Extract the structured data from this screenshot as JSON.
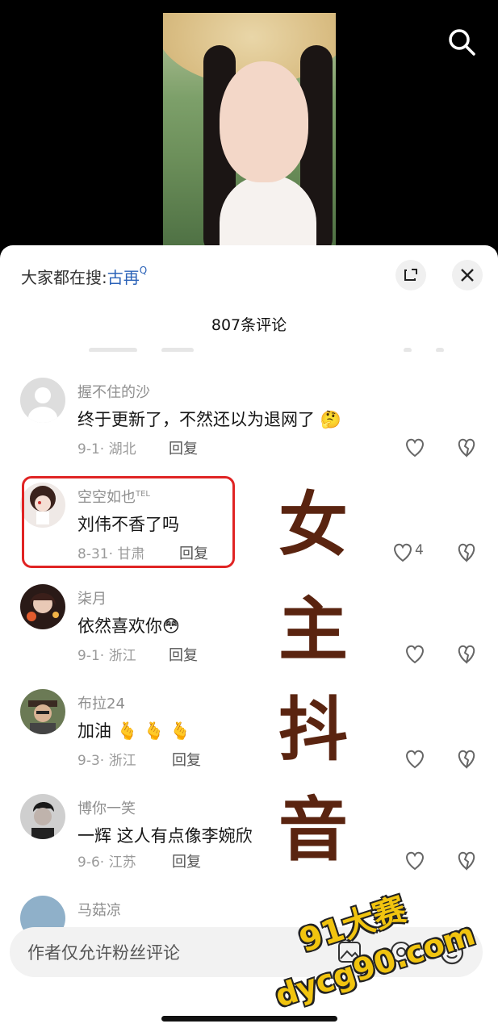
{
  "video": {
    "search_icon": "search-icon"
  },
  "sheet": {
    "hot_search_prefix": "大家都在搜:",
    "hot_search_keyword": "古再",
    "hot_search_mark": "Q",
    "comment_count": "807条评论",
    "expand_icon": "expand-icon",
    "close_icon": "close-icon"
  },
  "comments": [
    {
      "user": "握不住的沙",
      "badge": "",
      "text": "终于更新了，不然还以为退网了",
      "emoji": "🤔",
      "date": "9-1",
      "location": "湖北",
      "reply": "回复",
      "likes": ""
    },
    {
      "user": "空空如也",
      "badge": "TEL",
      "text": "刘伟不香了吗",
      "emoji": "",
      "date": "8-31",
      "location": "甘肃",
      "reply": "回复",
      "likes": "4"
    },
    {
      "user": "柒月",
      "badge": "",
      "text": "依然喜欢你",
      "emoji": "😳",
      "date": "9-1",
      "location": "浙江",
      "reply": "回复",
      "likes": ""
    },
    {
      "user": "布拉24",
      "badge": "",
      "text": "加油",
      "emoji": "🫰 🫰 🫰",
      "date": "9-3",
      "location": "浙江",
      "reply": "回复",
      "likes": ""
    },
    {
      "user": "博你一笑",
      "badge": "",
      "text": "一辉  这人有点像李婉欣",
      "emoji": "",
      "date": "9-6",
      "location": "江苏",
      "reply": "回复",
      "likes": ""
    },
    {
      "user": "马菇凉",
      "badge": "",
      "text": "",
      "emoji": "",
      "date": "",
      "location": "",
      "reply": "",
      "likes": ""
    }
  ],
  "overlay_text": [
    "女",
    "主",
    "抖",
    "音"
  ],
  "input": {
    "placeholder": "作者仅允许粉丝评论",
    "image_icon": "image-icon",
    "at_icon": "at-icon",
    "emoji_icon": "emoji-icon"
  },
  "watermark": {
    "line1": "91大赛",
    "line2": "dycg90.com"
  },
  "colors": {
    "accent": "#2c63b8",
    "highlight": "#e02424",
    "overlay": "#5a2410",
    "watermark": "#f1c40f"
  }
}
